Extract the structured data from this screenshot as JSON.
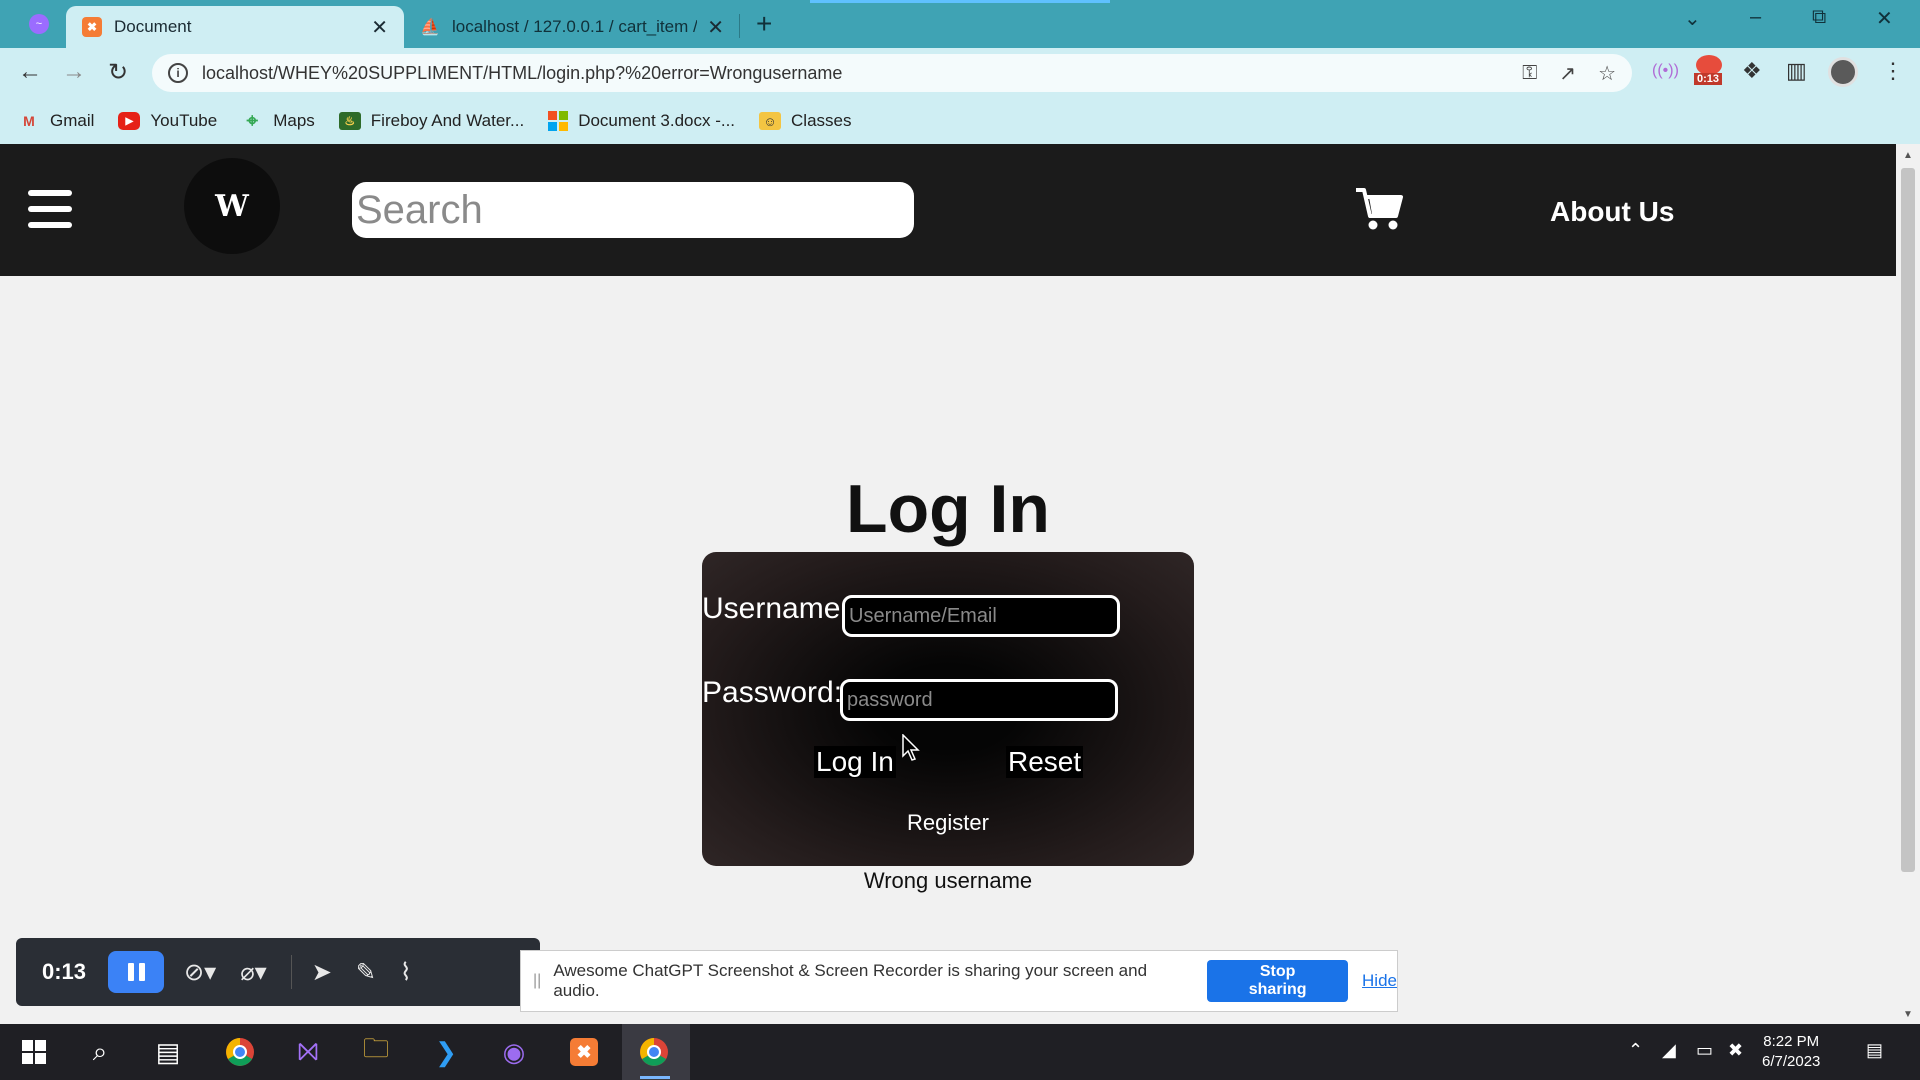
{
  "browser": {
    "tabs": [
      {
        "title": "Document",
        "active": true,
        "icon": "xampp-icon"
      },
      {
        "title": "localhost / 127.0.0.1 / cart_item /",
        "active": false,
        "icon": "phpmyadmin-icon"
      }
    ],
    "url": "localhost/WHEY%20SUPPLIMENT/HTML/login.php?%20error=Wrongusername",
    "recording_badge": "0:13",
    "bookmarks": [
      {
        "label": "Gmail",
        "icon": "gmail-icon"
      },
      {
        "label": "YouTube",
        "icon": "youtube-icon"
      },
      {
        "label": "Maps",
        "icon": "maps-icon"
      },
      {
        "label": "Fireboy And Water...",
        "icon": "game-icon"
      },
      {
        "label": "Document 3.docx -...",
        "icon": "microsoft-icon"
      },
      {
        "label": "Classes",
        "icon": "classroom-icon"
      }
    ]
  },
  "site": {
    "search_placeholder": "Search",
    "logo_text": "W",
    "about_label": "About Us"
  },
  "login": {
    "title": "Log In",
    "username_label": "Username:",
    "username_placeholder": "Username/Email",
    "password_label": "Password:",
    "password_placeholder": "password",
    "login_button": "Log In",
    "reset_button": "Reset",
    "register_link": "Register",
    "error_message": "Wrong username"
  },
  "recorder": {
    "time": "0:13"
  },
  "share_notice": {
    "text": "Awesome ChatGPT Screenshot & Screen Recorder is sharing your screen and audio.",
    "stop_label": "Stop sharing",
    "hide_label": "Hide"
  },
  "taskbar": {
    "time": "8:22 PM",
    "date": "6/7/2023"
  },
  "colors": {
    "chrome_tabstrip": "#3fa3b4",
    "chrome_toolbar": "#cfeef3",
    "site_header": "#1b1b1b",
    "share_button": "#1a73e8",
    "recorder_pause": "#3b82f6"
  }
}
